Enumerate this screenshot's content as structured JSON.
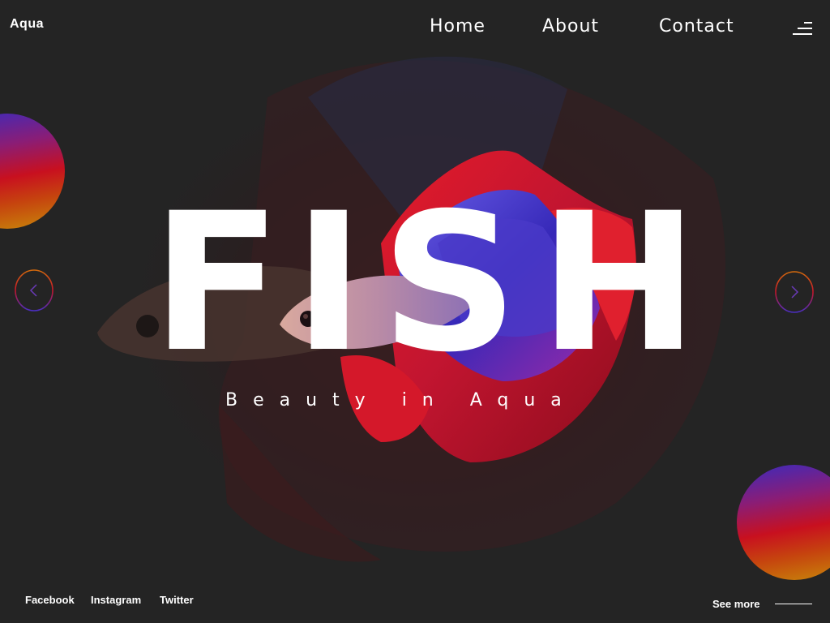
{
  "header": {
    "logo": "Aqua",
    "nav": [
      {
        "label": "Home"
      },
      {
        "label": "About"
      },
      {
        "label": "Contact"
      }
    ],
    "menu_icon": "hamburger-menu-icon"
  },
  "hero": {
    "letters": [
      "F",
      "I",
      "S",
      "H"
    ],
    "tagline": "Beauty in Aqua",
    "image": "betta-fish-image"
  },
  "controls": {
    "prev_icon": "chevron-left-icon",
    "next_icon": "chevron-right-icon"
  },
  "footer": {
    "socials": [
      {
        "label": "Facebook"
      },
      {
        "label": "Instagram"
      },
      {
        "label": "Twitter"
      }
    ],
    "see_more": "See more"
  },
  "colors": {
    "background": "#242424",
    "text": "#ffffff",
    "gradient_blue": "#3b2bbd",
    "gradient_red": "#c8101f",
    "gradient_gold": "#c88a0a"
  }
}
